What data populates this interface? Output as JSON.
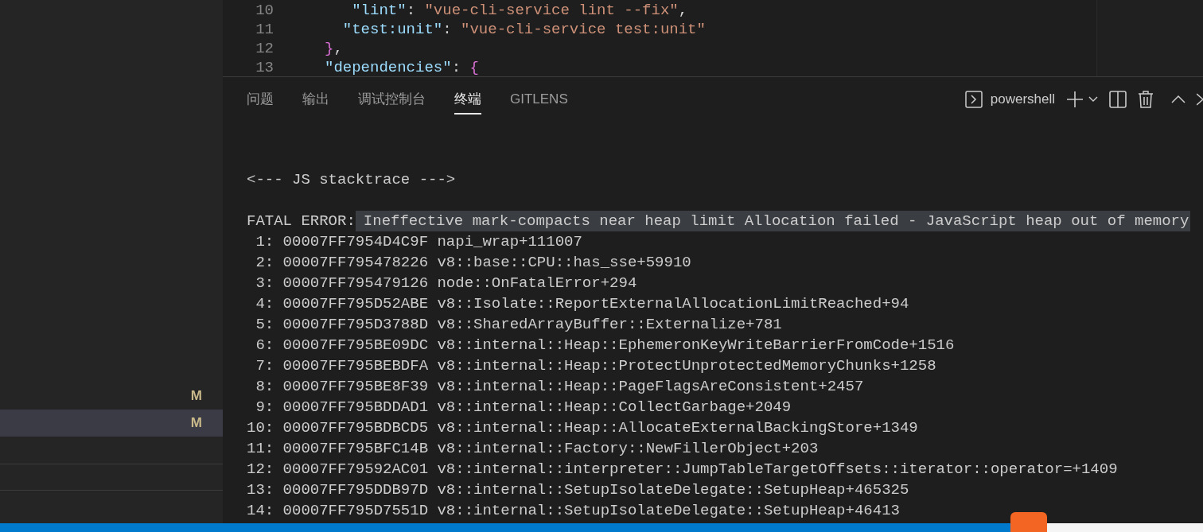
{
  "editor": {
    "lines": [
      {
        "number": "10",
        "tokens": [
          {
            "kind": "key",
            "text": "   \"lint\""
          },
          {
            "kind": "punct",
            "text": ": "
          },
          {
            "kind": "string",
            "text": "\"vue-cli-service lint --fix\""
          },
          {
            "kind": "punct",
            "text": ","
          }
        ]
      },
      {
        "number": "11",
        "tokens": [
          {
            "kind": "key",
            "text": "  \"test:unit\""
          },
          {
            "kind": "punct",
            "text": ": "
          },
          {
            "kind": "string",
            "text": "\"vue-cli-service test:unit\""
          }
        ]
      },
      {
        "number": "12",
        "tokens": [
          {
            "kind": "brace",
            "text": "}"
          },
          {
            "kind": "punct",
            "text": ","
          }
        ]
      },
      {
        "number": "13",
        "tokens": [
          {
            "kind": "key",
            "text": "\"dependencies\""
          },
          {
            "kind": "punct",
            "text": ": "
          },
          {
            "kind": "brace",
            "text": "{"
          }
        ]
      }
    ]
  },
  "sidebar": {
    "items": [
      {
        "badge": "M",
        "selected": false
      },
      {
        "badge": "M",
        "selected": true
      }
    ]
  },
  "panel": {
    "tabs": [
      {
        "label": "问题",
        "selected": false
      },
      {
        "label": "输出",
        "selected": false
      },
      {
        "label": "调试控制台",
        "selected": false
      },
      {
        "label": "终端",
        "selected": true
      },
      {
        "label": "GITLENS",
        "selected": false
      }
    ],
    "terminal_name": "powershell",
    "terminal": {
      "heading": "<--- JS stacktrace --->",
      "error_prefix": "FATAL ERROR:",
      "error_message": "Ineffective mark-compacts near heap limit Allocation failed - JavaScript heap out of memory",
      "error_highlighted": true,
      "frames": [
        " 1: 00007FF7954D4C9F napi_wrap+111007",
        " 2: 00007FF795478226 v8::base::CPU::has_sse+59910",
        " 3: 00007FF795479126 node::OnFatalError+294",
        " 4: 00007FF795D52ABE v8::Isolate::ReportExternalAllocationLimitReached+94",
        " 5: 00007FF795D3788D v8::SharedArrayBuffer::Externalize+781",
        " 6: 00007FF795BE09DC v8::internal::Heap::EphemeronKeyWriteBarrierFromCode+1516",
        " 7: 00007FF795BEBDFA v8::internal::Heap::ProtectUnprotectedMemoryChunks+1258",
        " 8: 00007FF795BE8F39 v8::internal::Heap::PageFlagsAreConsistent+2457",
        " 9: 00007FF795BDDAD1 v8::internal::Heap::CollectGarbage+2049",
        "10: 00007FF795BDBCD5 v8::internal::Heap::AllocateExternalBackingStore+1349",
        "11: 00007FF795BFC14B v8::internal::Factory::NewFillerObject+203",
        "12: 00007FF79592AC01 v8::internal::interpreter::JumpTableTargetOffsets::iterator::operator=+1409",
        "13: 00007FF795DDB97D v8::internal::SetupIsolateDelegate::SetupHeap+465325",
        "14: 00007FF795D7551D v8::internal::SetupIsolateDelegate::SetupHeap+46413"
      ]
    }
  }
}
